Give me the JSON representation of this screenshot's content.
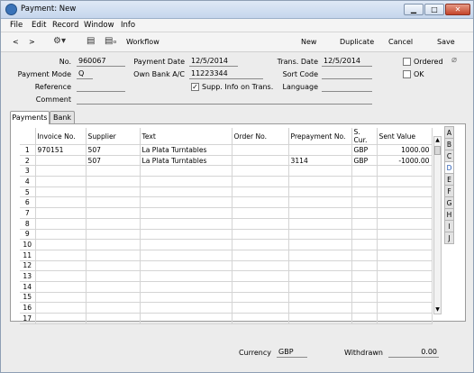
{
  "window": {
    "title": "Payment: New",
    "min_btn": "▁",
    "max_btn": "□",
    "close_btn": "✕"
  },
  "menu": [
    "File",
    "Edit",
    "Record",
    "Window",
    "Info"
  ],
  "toolbar": {
    "back": "<",
    "forward": ">",
    "workflow": "Workflow",
    "new": "New",
    "duplicate": "Duplicate",
    "cancel": "Cancel",
    "save": "Save"
  },
  "header": {
    "no_label": "No.",
    "no_value": "960067",
    "payment_date_label": "Payment Date",
    "payment_date_value": "12/5/2014",
    "trans_date_label": "Trans. Date",
    "trans_date_value": "12/5/2014",
    "ordered_label": "Ordered",
    "payment_mode_label": "Payment Mode",
    "payment_mode_value": "Q",
    "own_bank_label": "Own Bank A/C",
    "own_bank_value": "11223344",
    "sort_code_label": "Sort Code",
    "sort_code_value": "",
    "ok_label": "OK",
    "reference_label": "Reference",
    "reference_value": "",
    "supp_info_label": "Supp. Info on Trans.",
    "supp_info_checked": "✓",
    "language_label": "Language",
    "language_value": "",
    "comment_label": "Comment",
    "comment_value": ""
  },
  "tabs": [
    "Payments",
    "Bank"
  ],
  "grid": {
    "columns": [
      "Invoice No.",
      "Supplier",
      "Text",
      "Order No.",
      "Prepayment No.",
      "S. Cur.",
      "Sent Value"
    ],
    "rows": [
      {
        "n": "1",
        "invoice": "970151",
        "supplier": "507",
        "text": "La Plata Turntables",
        "order": "",
        "prepay": "",
        "cur": "GBP",
        "value": "1000.00"
      },
      {
        "n": "2",
        "invoice": "",
        "supplier": "507",
        "text": "La Plata Turntables",
        "order": "",
        "prepay": "3114",
        "cur": "GBP",
        "value": "-1000.00"
      },
      {
        "n": "3"
      },
      {
        "n": "4"
      },
      {
        "n": "5"
      },
      {
        "n": "6"
      },
      {
        "n": "7"
      },
      {
        "n": "8"
      },
      {
        "n": "9"
      },
      {
        "n": "10"
      },
      {
        "n": "11"
      },
      {
        "n": "12"
      },
      {
        "n": "13"
      },
      {
        "n": "14"
      },
      {
        "n": "15"
      },
      {
        "n": "16"
      },
      {
        "n": "17"
      }
    ],
    "scroll_up": "▲",
    "scroll_down": "▼"
  },
  "side_tabs": [
    "A",
    "B",
    "C",
    "D",
    "E",
    "F",
    "G",
    "H",
    "I",
    "J"
  ],
  "side_tab_active": "D",
  "footer": {
    "currency_label": "Currency",
    "currency_value": "GBP",
    "withdrawn_label": "Withdrawn",
    "withdrawn_value": "0.00"
  }
}
